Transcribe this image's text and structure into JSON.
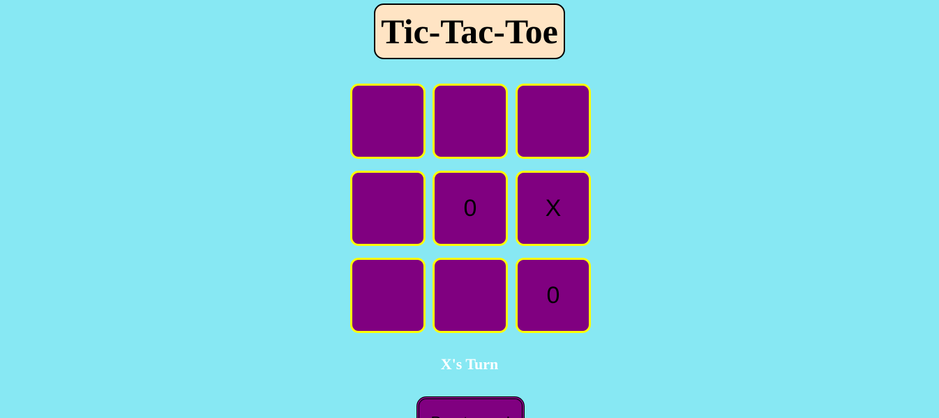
{
  "title": "Tic-Tac-Toe",
  "board": {
    "cells": [
      "",
      "",
      "",
      "",
      "0",
      "X",
      "",
      "",
      "0"
    ]
  },
  "status": "X's Turn",
  "reset_label": "Reset game!",
  "colors": {
    "background": "#87e8f3",
    "title_bg": "#ffe4c4",
    "cell_bg": "#800080",
    "cell_border": "#ffff00",
    "status_text": "#ffffff"
  }
}
